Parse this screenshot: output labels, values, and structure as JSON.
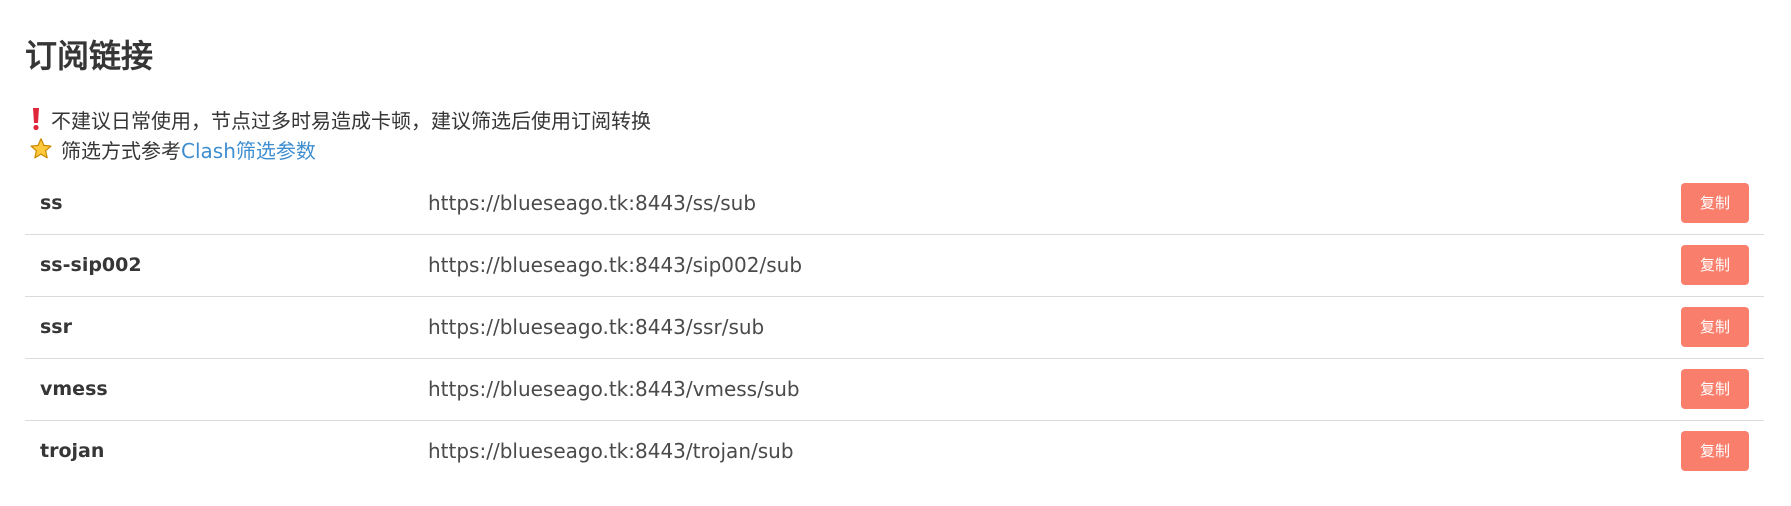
{
  "page": {
    "title": "订阅链接"
  },
  "notes": {
    "warning": {
      "icon": "exclamation-icon",
      "text": "不建议日常使用，节点过多时易造成卡顿，建议筛选后使用订阅转换"
    },
    "filter": {
      "icon": "star-icon",
      "text": "筛选方式参考",
      "link_text": "Clash筛选参数"
    }
  },
  "subscriptions": [
    {
      "name": "ss",
      "url": "https://blueseago.tk:8443/ss/sub",
      "button": "复制"
    },
    {
      "name": "ss-sip002",
      "url": "https://blueseago.tk:8443/sip002/sub",
      "button": "复制"
    },
    {
      "name": "ssr",
      "url": "https://blueseago.tk:8443/ssr/sub",
      "button": "复制"
    },
    {
      "name": "vmess",
      "url": "https://blueseago.tk:8443/vmess/sub",
      "button": "复制"
    },
    {
      "name": "trojan",
      "url": "https://blueseago.tk:8443/trojan/sub",
      "button": "复制"
    }
  ],
  "colors": {
    "button_bg": "#f97e6b",
    "link": "#3e8ed0",
    "warning_icon": "#e0263a",
    "star_icon": "#ffc83d"
  }
}
